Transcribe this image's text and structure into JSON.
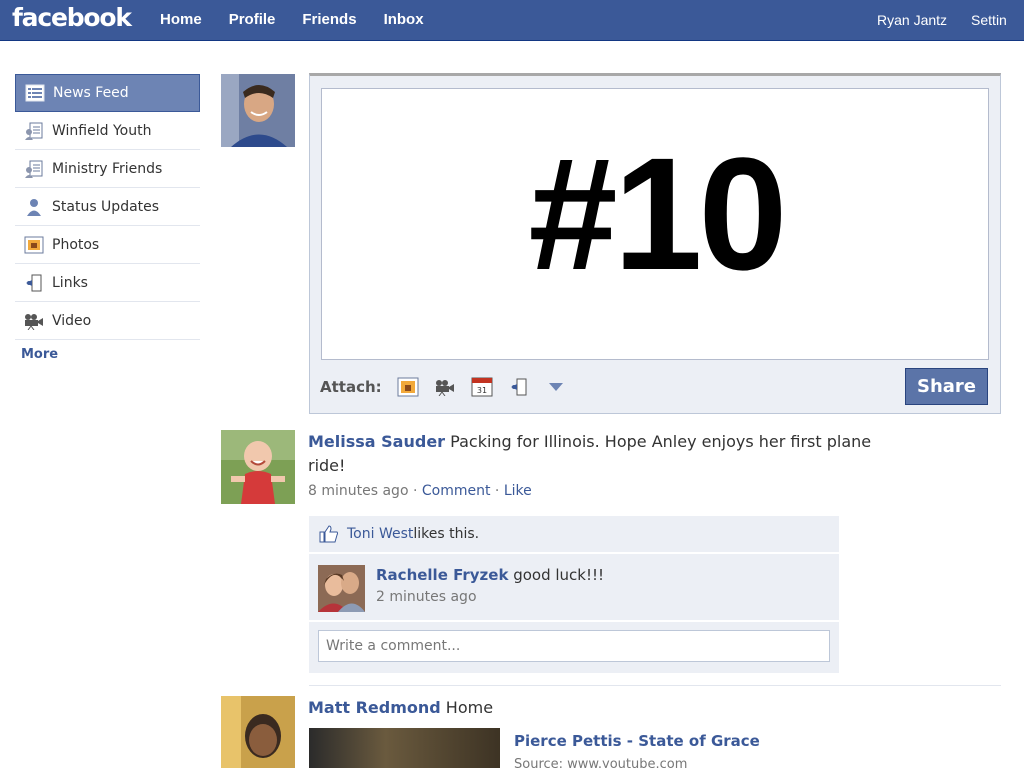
{
  "header": {
    "logo": "facebook",
    "nav": [
      "Home",
      "Profile",
      "Friends",
      "Inbox"
    ],
    "user_name": "Ryan Jantz",
    "settings_label": "Settin"
  },
  "sidebar": {
    "items": [
      {
        "label": "News Feed",
        "icon": "news-feed-icon"
      },
      {
        "label": "Winfield Youth",
        "icon": "friend-list-icon"
      },
      {
        "label": "Ministry Friends",
        "icon": "friend-list-icon"
      },
      {
        "label": "Status Updates",
        "icon": "status-person-icon"
      },
      {
        "label": "Photos",
        "icon": "photos-icon"
      },
      {
        "label": "Links",
        "icon": "links-icon"
      },
      {
        "label": "Video",
        "icon": "video-camera-icon"
      }
    ],
    "more_label": "More"
  },
  "composer": {
    "text": "#10",
    "attach_label": "Attach:",
    "attach_icons": [
      "photo-icon",
      "video-icon",
      "event-icon",
      "link-icon",
      "dropdown-arrow-icon"
    ],
    "share_label": "Share"
  },
  "story1": {
    "author": "Melissa Sauder",
    "message_line1": "Packing for Illinois. Hope Anley enjoys her first plane",
    "message_line2": "ride!",
    "time": "8 minutes ago",
    "separator": " · ",
    "comment_label": "Comment",
    "like_label": "Like",
    "likes_name": "Toni West",
    "likes_suffix": " likes this.",
    "comment": {
      "author": "Rachelle Fryzek",
      "text": " good luck!!!",
      "time": "2 minutes ago"
    },
    "comment_placeholder": "Write a comment..."
  },
  "story2": {
    "author": "Matt Redmond",
    "message": " Home",
    "attachment_title": "Pierce Pettis - State of Grace",
    "attachment_source": "Source: www.youtube.com"
  },
  "colors": {
    "brand_blue": "#3b5998",
    "sidebar_active": "#6d84b4",
    "light_panel": "#eceff5"
  }
}
